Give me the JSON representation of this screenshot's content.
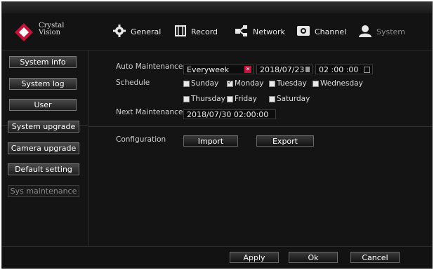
{
  "brand": {
    "line1": "Crystal",
    "line2": "Vision",
    "logo_color": "#c2143a"
  },
  "nav": [
    {
      "label": "General",
      "icon": "gear-icon"
    },
    {
      "label": "Record",
      "icon": "film-icon"
    },
    {
      "label": "Network",
      "icon": "network-icon"
    },
    {
      "label": "Channel",
      "icon": "camera-icon"
    },
    {
      "label": "System",
      "icon": "user-icon"
    }
  ],
  "sidebar": {
    "items": [
      {
        "label": "System info"
      },
      {
        "label": "System log"
      },
      {
        "label": "User"
      },
      {
        "label": "System upgrade"
      },
      {
        "label": "Camera upgrade"
      },
      {
        "label": "Default setting"
      },
      {
        "label": "Sys maintenance"
      }
    ]
  },
  "maintenance": {
    "auto_label": "Auto Maintenance",
    "auto_value": "Everyweek",
    "date": "2018/07/23",
    "time": "02 :00 :00",
    "schedule_label": "Schedule",
    "days": [
      {
        "label": "Sunday",
        "checked": false
      },
      {
        "label": "Monday",
        "checked": true
      },
      {
        "label": "Tuesday",
        "checked": false
      },
      {
        "label": "Wednesday",
        "checked": false
      },
      {
        "label": "Thursday",
        "checked": false
      },
      {
        "label": "Friday",
        "checked": false
      },
      {
        "label": "Saturday",
        "checked": false
      }
    ],
    "next_label": "Next Maintenance",
    "next_value": "2018/07/30 02:00:00"
  },
  "configuration": {
    "label": "Configuration",
    "import": "Import",
    "export": "Export"
  },
  "footer": {
    "apply": "Apply",
    "ok": "Ok",
    "cancel": "Cancel"
  }
}
